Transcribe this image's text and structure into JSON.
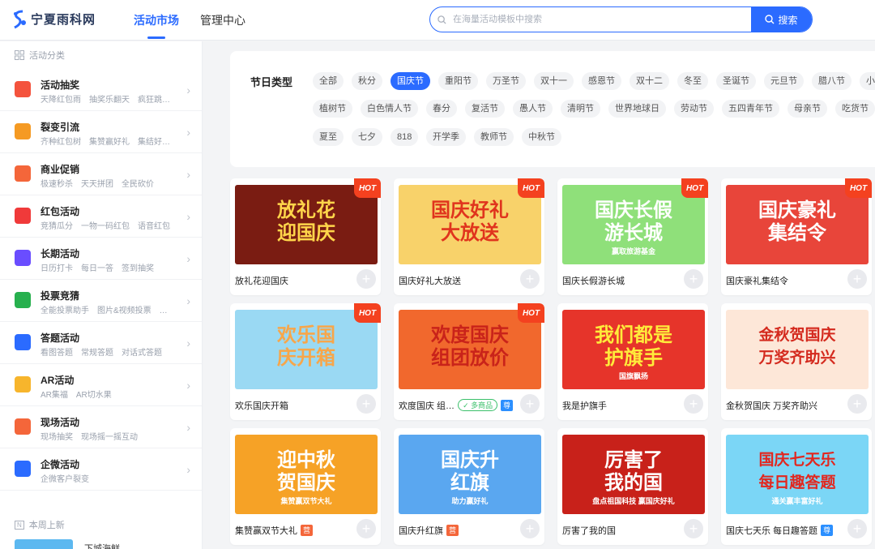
{
  "header": {
    "logo_text": "宁夏雨科网",
    "nav": [
      {
        "label": "活动市场",
        "active": true
      },
      {
        "label": "管理中心",
        "active": false
      }
    ],
    "search": {
      "placeholder": "在海量活动模板中搜索",
      "button_label": "搜索"
    }
  },
  "sidebar": {
    "heading": "活动分类",
    "items": [
      {
        "title": "活动抽奖",
        "sub": "天降红包雨　抽奖乐翻天　疯狂跳跳…",
        "icon": "gift-icon",
        "color": "#f4533d"
      },
      {
        "title": "裂变引流",
        "sub": "齐种红包树　集赞赢好礼　集结好友…",
        "icon": "user-icon",
        "color": "#f59a23"
      },
      {
        "title": "商业促销",
        "sub": "极速秒杀　天天拼团　全民砍价",
        "icon": "price-tag-icon",
        "color": "#f4663a"
      },
      {
        "title": "红包活动",
        "sub": "竞猜瓜分　一物一码红包　语音红包",
        "icon": "red-envelope-icon",
        "color": "#f03a3a"
      },
      {
        "title": "长期活动",
        "sub": "日历打卡　每日一答　签到抽奖",
        "icon": "calendar-icon",
        "color": "#6a4dff"
      },
      {
        "title": "投票竞猜",
        "sub": "全能投票助手　图片&视频投票　多…",
        "icon": "vote-icon",
        "color": "#27b04e"
      },
      {
        "title": "答题活动",
        "sub": "看图答题　常规答题　对话式答题",
        "icon": "question-icon",
        "color": "#2b6bff"
      },
      {
        "title": "AR活动",
        "sub": "AR集福　AR切水果",
        "icon": "robot-icon",
        "color": "#f7b52c"
      },
      {
        "title": "现场活动",
        "sub": "现场抽奖　现场摇一摇互动",
        "icon": "screen-icon",
        "color": "#f4663a"
      },
      {
        "title": "企微活动",
        "sub": "企微客户裂变",
        "icon": "wecom-icon",
        "color": "#2b6bff"
      }
    ],
    "new_heading": "本周上新",
    "new_item": "下城海鲜"
  },
  "filter": {
    "label": "节日类型",
    "tags": [
      "全部",
      "秋分",
      "国庆节",
      "重阳节",
      "万圣节",
      "双十一",
      "感恩节",
      "双十二",
      "冬至",
      "圣诞节",
      "元旦节",
      "腊八节",
      "小年",
      "植树节",
      "白色情人节",
      "春分",
      "复活节",
      "愚人节",
      "清明节",
      "世界地球日",
      "劳动节",
      "五四青年节",
      "母亲节",
      "吃货节",
      "夏至",
      "七夕",
      "818",
      "开学季",
      "教师节",
      "中秋节"
    ],
    "active": "国庆节"
  },
  "cards": [
    {
      "name": "放礼花迎国庆",
      "art": "放礼花迎国庆",
      "hot": true,
      "bg": "#7a1c12",
      "fg": "#ffd54a"
    },
    {
      "name": "国庆好礼大放送",
      "art": "国庆好礼大放送",
      "hot": true,
      "bg": "#f8d26a",
      "fg": "#e0341d"
    },
    {
      "name": "国庆长假游长城",
      "art": "国庆长假游长城",
      "hot": true,
      "bg": "#8fe07a",
      "fg": "#ffffff",
      "sub": "赢取旅游基金"
    },
    {
      "name": "国庆豪礼集结令",
      "art": "国庆豪礼集结令",
      "hot": true,
      "bg": "#e8453a",
      "fg": "#ffffff"
    },
    {
      "name": "欢乐国庆开箱",
      "art": "欢乐国庆开箱",
      "hot": true,
      "bg": "#9ad9f3",
      "fg": "#f7a64a"
    },
    {
      "name": "欢度国庆 组…",
      "art": "欢度国庆组团放价",
      "hot": true,
      "bg": "#f1682d",
      "fg": "#c9231a",
      "multi": "多商品",
      "badge": "尊"
    },
    {
      "name": "我是护旗手",
      "art": "我们都是护旗手",
      "hot": false,
      "bg": "#e6342a",
      "fg": "#ffeb3b",
      "sub": "国旗飘扬"
    },
    {
      "name": "金秋贺国庆 万奖齐助兴",
      "art": "金秋贺国庆万奖齐助兴",
      "hot": false,
      "bg": "#fde7d8",
      "fg": "#d42a1e"
    },
    {
      "name": "集赞赢双节大礼",
      "art": "迎中秋贺国庆",
      "hot": false,
      "bg": "#f6a226",
      "fg": "#ffffff",
      "sub": "集赞赢双节大礼",
      "badge2": "营"
    },
    {
      "name": "国庆升红旗",
      "art": "国庆升红旗",
      "hot": false,
      "bg": "#5aa7f0",
      "fg": "#ffffff",
      "sub": "助力赢好礼",
      "badge2": "营"
    },
    {
      "name": "厉害了我的国",
      "art": "厉害了我的国",
      "hot": false,
      "bg": "#c8211a",
      "fg": "#ffffff",
      "sub": "盘点祖国科技 赢国庆好礼"
    },
    {
      "name": "国庆七天乐 每日趣答题",
      "art": "国庆七天乐每日趣答题",
      "hot": false,
      "bg": "#7bd6f6",
      "fg": "#e2271f",
      "sub": "通关赢丰富好礼",
      "badge": "尊"
    }
  ],
  "hot_label": "HOT"
}
